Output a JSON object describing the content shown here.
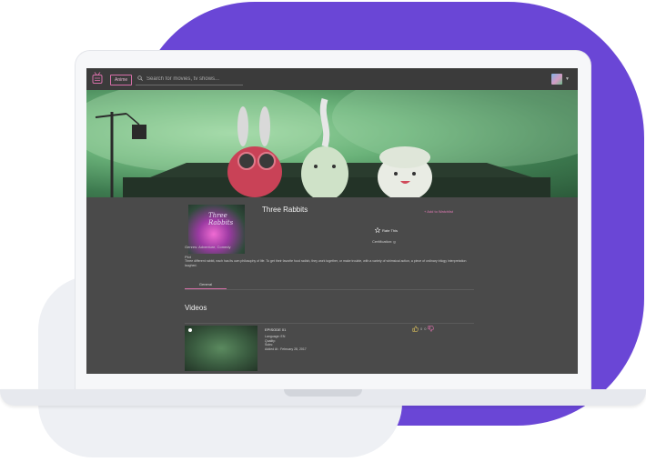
{
  "header": {
    "genre_button": "Anime",
    "search_placeholder": "Search for movies, tv shows..."
  },
  "show": {
    "title": "Three Rabbits",
    "poster_text": "Three Rabbits",
    "add_to_watchlist": "+ Add to Watchlist",
    "rate_label": "Rate This",
    "certification": "Certification: g",
    "genres": "Genres: Adventure, Comedy",
    "plot_label": "Plot",
    "plot": "Three different rabbit, each has its own philosophy of life. To get their favorite food radish, they work together, or make trouble, with a variety of whimsical action, a piece of ordinary trilogy interpretation laughed."
  },
  "tabs": [
    {
      "label": "General",
      "active": true
    }
  ],
  "videos": {
    "heading": "Videos",
    "items": [
      {
        "title": "EPISODE 01",
        "language": "Language: EN",
        "quality": "Quality:",
        "subs": "Subs:",
        "added": "Added At : February 28, 2017",
        "likes": "0",
        "dislikes": "0"
      }
    ]
  },
  "colors": {
    "accent": "#d66fa8",
    "frame_purple": "#6a46d6",
    "screen_bg": "#4a4a4a",
    "topbar_bg": "#3b3b3b"
  },
  "icons": [
    "tv-logo-icon",
    "search-icon",
    "star-icon",
    "thumbs-up-icon",
    "thumbs-down-icon",
    "avatar-icon"
  ]
}
